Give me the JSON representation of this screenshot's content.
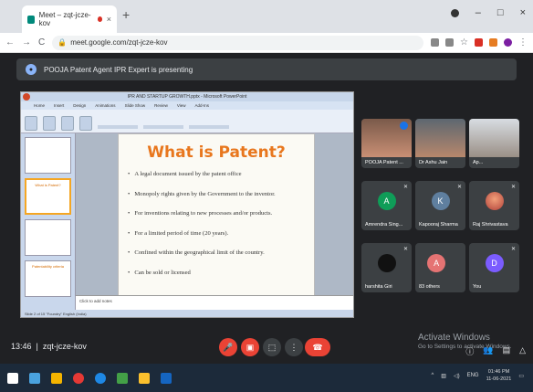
{
  "browser": {
    "tab_title": "Meet – zqt-jcze-kov",
    "url": "meet.google.com/zqt-jcze-kov",
    "nav_back": "←",
    "nav_forward": "→",
    "reload": "C",
    "new_tab": "+",
    "minimize": "–",
    "restore": "□",
    "close": "×"
  },
  "meet": {
    "presenting_banner": "POOJA Patent Agent IPR Expert is presenting",
    "meeting_time": "13:46",
    "meeting_code": "zqt-jcze-kov",
    "participants": [
      {
        "name": "POOJA Patent ...",
        "type": "photo"
      },
      {
        "name": "Dr Ashu Jain",
        "type": "photo"
      },
      {
        "name": "Ap...",
        "type": "photo"
      },
      {
        "name": "Amrendra Sing...",
        "initial": "A",
        "color": "#0f9d58"
      },
      {
        "name": "Kapooraj Sharma",
        "initial": "K",
        "color": "#5f7f9f"
      },
      {
        "name": "Raj Shrivastava",
        "type": "photo"
      },
      {
        "name": "harshita Giri",
        "type": "photo"
      },
      {
        "name": "83 others",
        "initial": "A",
        "color": "#e57373"
      },
      {
        "name": "You",
        "initial": "D",
        "color": "#7b5cff"
      }
    ],
    "activate_title": "Activate Windows",
    "activate_sub": "Go to Settings to activate Windows."
  },
  "slide": {
    "window_title": "IPR AND STARTUP GROWTH.pptx - Microsoft PowerPoint",
    "ribbon_tabs": [
      "Home",
      "Insert",
      "Design",
      "Animations",
      "Slide Show",
      "Review",
      "View",
      "Add-Ins"
    ],
    "title": "What is Patent?",
    "bullets": [
      "A legal document issued by the patent office",
      "Monopoly rights given by the Government to the inventor.",
      "For inventions relating to new processes and/or products.",
      "For a limited period of time (20 years).",
      "Confined within the geographical limit of the country.",
      "Can be sold or licensed"
    ],
    "notes_placeholder": "Click to add notes",
    "status": "Slide 2 of 15    \"Foundry\"    English (India)",
    "thumb_labels": [
      "",
      "What is Patent?",
      "",
      "Patentability criteria"
    ]
  },
  "taskbar": {
    "tray_lang": "ENG",
    "time": "01:46 PM",
    "date": "11-06-2021"
  }
}
